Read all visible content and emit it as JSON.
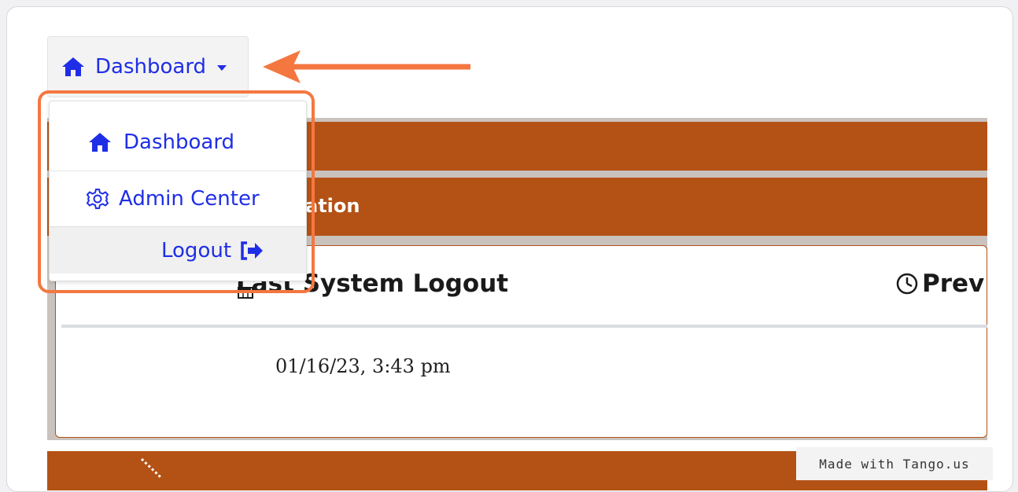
{
  "toolbar": {
    "dashboard_label": "Dashboard",
    "accent_color": "#1f2ee6"
  },
  "dropdown": {
    "items": [
      {
        "label": "Dashboard",
        "icon": "home-icon"
      },
      {
        "label": "Admin Center",
        "icon": "gear-icon"
      },
      {
        "label": "Logout",
        "icon": "logout-icon"
      }
    ]
  },
  "background": {
    "bar_text": "ation",
    "card_title": "Last System Logout",
    "card_title_icon": "calendar-icon",
    "prev_label": "Prev",
    "prev_icon": "clock-icon",
    "date_value": "01/16/23, 3:43 pm",
    "brand_color": "#b45216"
  },
  "annotation": {
    "highlight_color": "#f47740"
  },
  "watermark": {
    "text": "Made with Tango.us"
  }
}
